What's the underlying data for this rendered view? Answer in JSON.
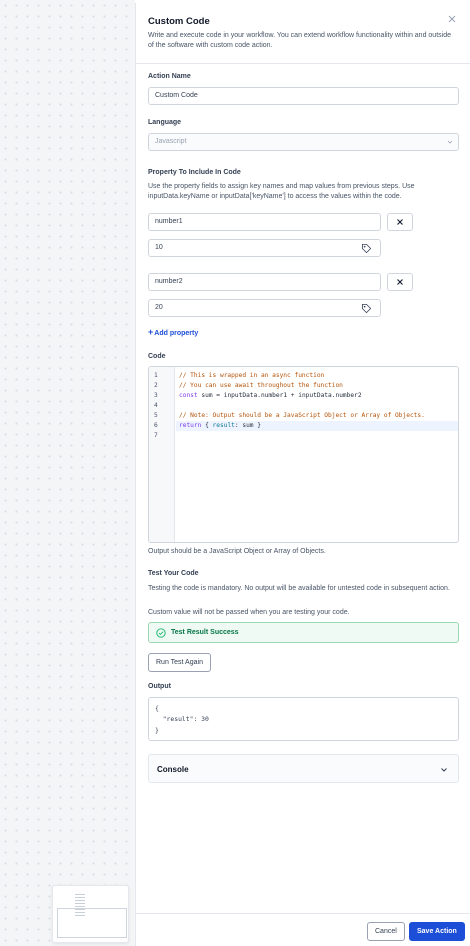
{
  "panel": {
    "title": "Custom Code",
    "description": "Write and execute code in your workflow. You can extend workflow functionality within and outside of the software with custom code action.",
    "close_icon": "close-icon"
  },
  "action_name": {
    "label": "Action Name",
    "value": "Custom Code"
  },
  "language": {
    "label": "Language",
    "value": "Javascript"
  },
  "properties": {
    "label": "Property To Include In Code",
    "help": "Use the property fields to assign key names and map values from previous steps. Use inputData.keyName or inputData['keyName'] to access the values within the code.",
    "items": [
      {
        "key": "number1",
        "value": "10"
      },
      {
        "key": "number2",
        "value": "20"
      }
    ],
    "add_label": "Add property",
    "add_plus": "+"
  },
  "code": {
    "label": "Code",
    "line_numbers": [
      "1",
      "2",
      "3",
      "4",
      "5",
      "6",
      "7"
    ],
    "lines": {
      "l1": "// This is wrapped in an async function",
      "l2": "// You can use await throughout the function",
      "l3a": "const",
      "l3b": " sum = inputData.number1 + inputData.number2",
      "l5": "// Note: Output should be a JavaScript Object or Array of Objects.",
      "l6a": "return",
      "l6b": " { ",
      "l6c": "result",
      "l6d": ": sum }"
    },
    "note": "Output should be a JavaScript Object or Array of Objects."
  },
  "test": {
    "label": "Test Your Code",
    "help1": "Testing the code is mandatory. No output will be available for untested code in subsequent action.",
    "help2": "Custom value will not be passed when you are testing your code.",
    "success": "Test Result Success",
    "run_again": "Run Test Again"
  },
  "output": {
    "label": "Output",
    "lines": [
      "{",
      "  \"result\": 30",
      "}"
    ]
  },
  "console": {
    "label": "Console"
  },
  "footer": {
    "cancel": "Cancel",
    "save": "Save Action"
  },
  "colors": {
    "primary": "#1d4ed8",
    "success": "#067647",
    "border": "#d0d5dd"
  }
}
